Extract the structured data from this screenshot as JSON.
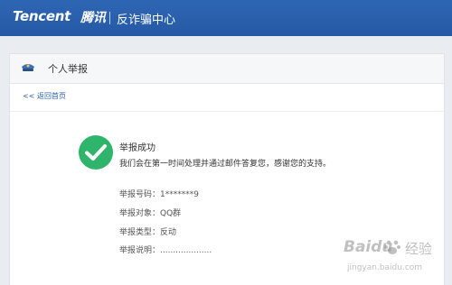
{
  "header": {
    "brand_en": "Tencent",
    "brand_cn": "腾讯",
    "title": "反诈骗中心"
  },
  "panel": {
    "icon": "police-cap-icon",
    "title": "个人举报",
    "back_link": "<< 返回首页"
  },
  "result": {
    "icon": "check-circle-icon",
    "title": "举报成功",
    "message": "我们会在第一时间处理并通过邮件答复您，感谢您的支持。",
    "details": [
      "举报号码：1*******9",
      "举报对象：QQ群",
      "举报类型：反动",
      "举报说明：...................."
    ]
  },
  "watermark": {
    "brand": "Baidu",
    "cn": "经验",
    "url": "jingyan.baidu.com"
  },
  "colors": {
    "header_blue": "#2c62ae",
    "success_green": "#2fb46b",
    "link_blue": "#2b62b2"
  }
}
